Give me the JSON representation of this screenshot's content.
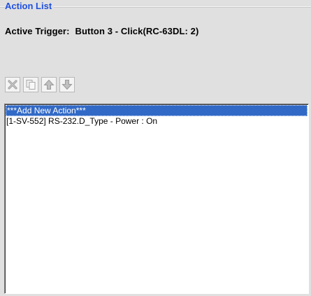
{
  "group": {
    "title": "Action List"
  },
  "trigger": {
    "label": "Active Trigger:",
    "value": "Button 3 - Click(RC-63DL: 2)"
  },
  "toolbar": {
    "buttons": [
      {
        "icon": "delete-icon",
        "enabled": false
      },
      {
        "icon": "copy-icon",
        "enabled": false
      },
      {
        "icon": "arrow-up-icon",
        "enabled": false
      },
      {
        "icon": "arrow-down-icon",
        "enabled": false
      }
    ]
  },
  "actions": {
    "items": [
      {
        "label": "***Add New Action***",
        "selected": true
      },
      {
        "label": "[1-SV-552] RS-232.D_Type - Power : On",
        "selected": false
      }
    ]
  },
  "colors": {
    "title_blue": "#1f4fe0",
    "selection": "#3169c6",
    "panel_bg": "#e0e0e0"
  }
}
